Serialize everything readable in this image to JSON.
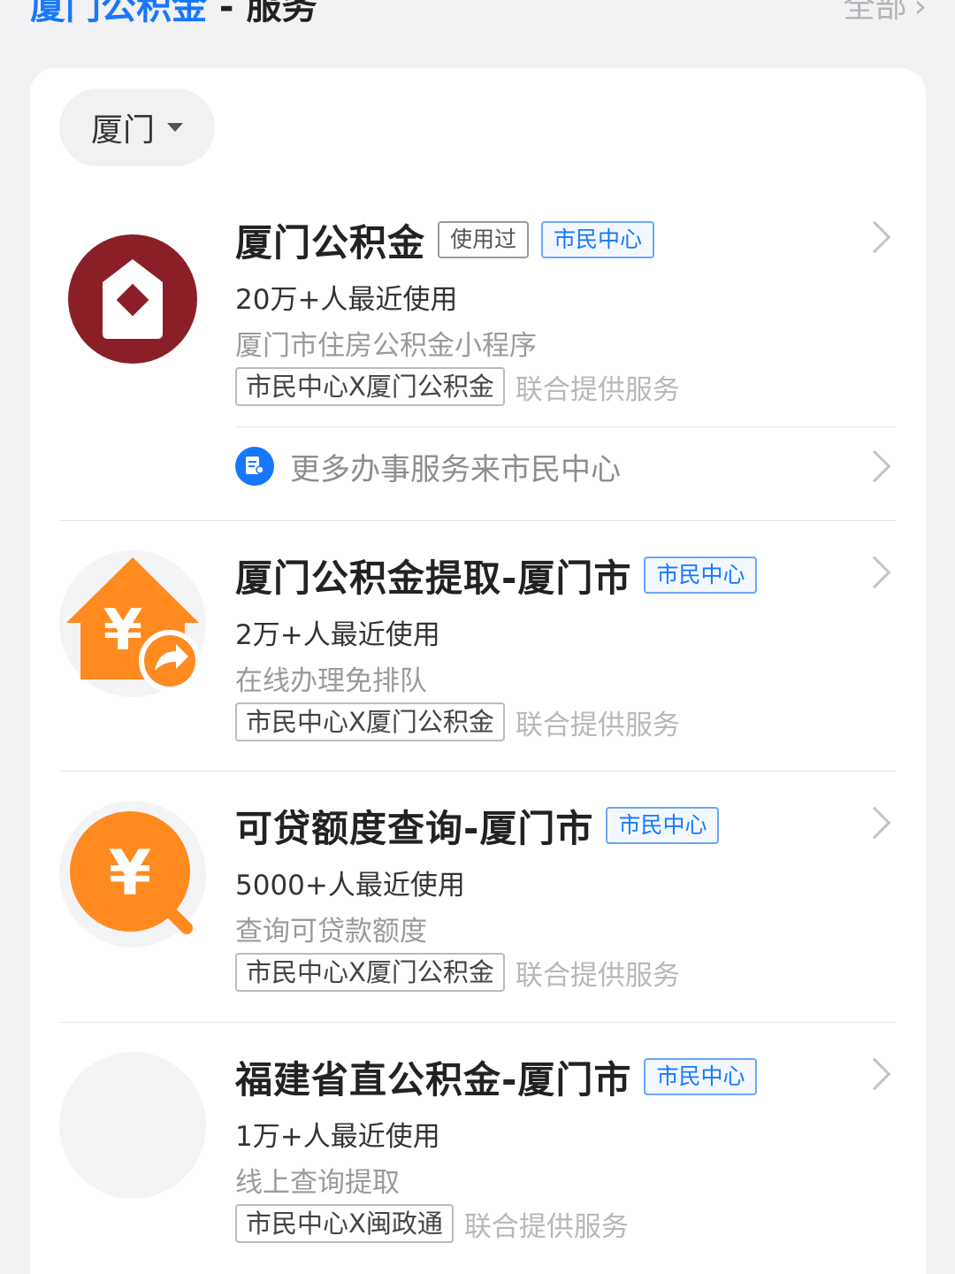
{
  "header": {
    "title_highlight": "厦门公积金",
    "title_rest": " - 服务",
    "all_label": "全部"
  },
  "filter": {
    "city": "厦门"
  },
  "services": [
    {
      "title": "厦门公积金",
      "tags": [
        "使用过",
        "市民中心"
      ],
      "users": "20万+人最近使用",
      "description": "厦门市住房公积金小程序",
      "provider": "市民中心X厦门公积金",
      "provider_suffix": "联合提供服务",
      "icon": "house-diamond-icon"
    },
    {
      "title": "厦门公积金提取-厦门市",
      "tags": [
        "市民中心"
      ],
      "users": "2万+人最近使用",
      "description": "在线办理免排队",
      "provider": "市民中心X厦门公积金",
      "provider_suffix": "联合提供服务",
      "icon": "house-yuan-transfer-icon"
    },
    {
      "title": "可贷额度查询-厦门市",
      "tags": [
        "市民中心"
      ],
      "users": "5000+人最近使用",
      "description": "查询可贷款额度",
      "provider": "市民中心X厦门公积金",
      "provider_suffix": "联合提供服务",
      "icon": "yuan-search-icon"
    },
    {
      "title": "福建省直公积金-厦门市",
      "tags": [
        "市民中心"
      ],
      "users": "1万+人最近使用",
      "description": "线上查询提取",
      "provider": "市民中心X闽政通",
      "provider_suffix": "联合提供服务",
      "icon": "placeholder-icon"
    }
  ],
  "more_services": {
    "label": "更多办事服务来市民中心",
    "icon": "citizen-center-icon"
  },
  "colors": {
    "brand_blue": "#1677ff",
    "icon_red": "#8b1f27",
    "icon_orange": "#ff8a1f"
  }
}
